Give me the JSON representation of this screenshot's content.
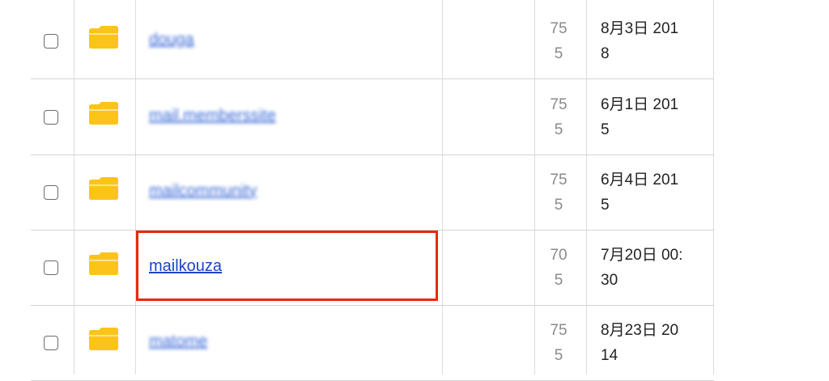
{
  "rows": [
    {
      "name": "douga",
      "perm_line1": "75",
      "perm_line2": "5",
      "date_line1": "8月3日 201",
      "date_line2": "8"
    },
    {
      "name": "mail.memberssite",
      "perm_line1": "75",
      "perm_line2": "5",
      "date_line1": "6月1日 201",
      "date_line2": "5"
    },
    {
      "name": "mailcommunity",
      "perm_line1": "75",
      "perm_line2": "5",
      "date_line1": "6月4日 201",
      "date_line2": "5"
    },
    {
      "name": "mailkouza",
      "perm_line1": "70",
      "perm_line2": "5",
      "date_line1": "7月20日 00:",
      "date_line2": "30"
    },
    {
      "name": "matome",
      "perm_line1": "75",
      "perm_line2": "5",
      "date_line1": "8月23日 20",
      "date_line2": "14"
    }
  ],
  "colors": {
    "folder": "#fcc419",
    "link": "#1a44c8",
    "highlight": "#e8290b"
  },
  "icons": {
    "folder": "folder-icon",
    "checkbox": "checkbox-icon"
  }
}
